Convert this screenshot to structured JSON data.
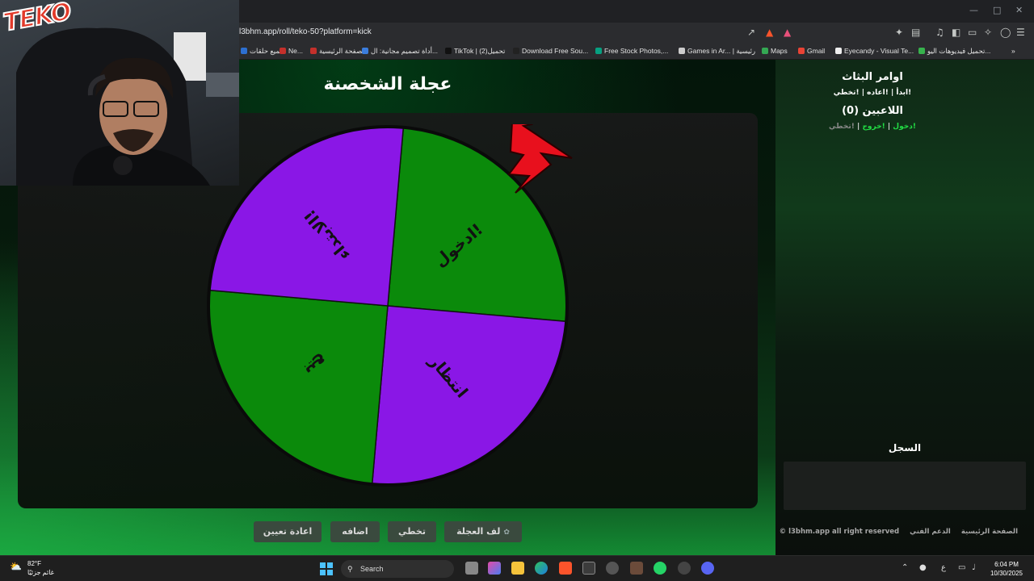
{
  "browser": {
    "url": "l3bhm.app/roll/teko-50?platform=kick",
    "bookmarks": [
      {
        "label": "جميع حلقات",
        "color": "#2d6fd0"
      },
      {
        "label": "Ne...",
        "color": "#c4302b"
      },
      {
        "label": "الصفحة الرئيسية",
        "color": "#c4302b"
      },
      {
        "label": "أداة تصميم مجانية: ال...",
        "color": "#3b7ddd"
      },
      {
        "label": "TikTok | تحميل(2)",
        "color": "#111111"
      },
      {
        "label": "Download Free Sou...",
        "color": "#222222"
      },
      {
        "label": "Free Stock Photos,...",
        "color": "#07a081"
      },
      {
        "label": "Games in Ar... | رئيسية",
        "color": "#cccccc"
      },
      {
        "label": "Maps",
        "color": "#34a853"
      },
      {
        "label": "Gmail",
        "color": "#ea4335"
      },
      {
        "label": "Eyecandy - Visual Te...",
        "color": "#eeeeee"
      },
      {
        "label": "تحميل فيديوهات اليو...",
        "color": "#37b24d"
      }
    ]
  },
  "webcam": {
    "logo_text": "TEKO"
  },
  "wheel": {
    "title": "عجلة الشخصنة",
    "segments": [
      {
        "label": "ادخول!",
        "color": "#0b8a0b"
      },
      {
        "label": "انتظار",
        "color": "#8a17e6"
      },
      {
        "label": "بيع",
        "color": "#0b8a0b"
      },
      {
        "label": "الابتداء!",
        "color": "#8a17e6"
      }
    ],
    "pointer_color": "#e8101d"
  },
  "controls": {
    "spin_label": "لف العجلة",
    "skip_label": "تخطي",
    "add_label": "اضافه",
    "reset_label": "اعادة تعيين"
  },
  "sidebar": {
    "commands_title": "اوامر البثاث",
    "commands_text": "!ابدأ | !اعاده | !تخطي",
    "players_title": "اللاعبين (0)",
    "link_join": "!دخول",
    "link_exit": "!خروج",
    "link_skip": "!تخطي",
    "log_title": "السجل"
  },
  "footer": {
    "home": "الصفحة الرئيسية",
    "support": "الدعم الفني",
    "copyright": "l3bhm.app all right reserved ©"
  },
  "taskbar": {
    "temperature": "82°F",
    "weather_desc": "غائم جزئيًا",
    "search_placeholder": "Search",
    "language": "ع",
    "time": "6:04 PM",
    "date": "10/30/2025"
  }
}
